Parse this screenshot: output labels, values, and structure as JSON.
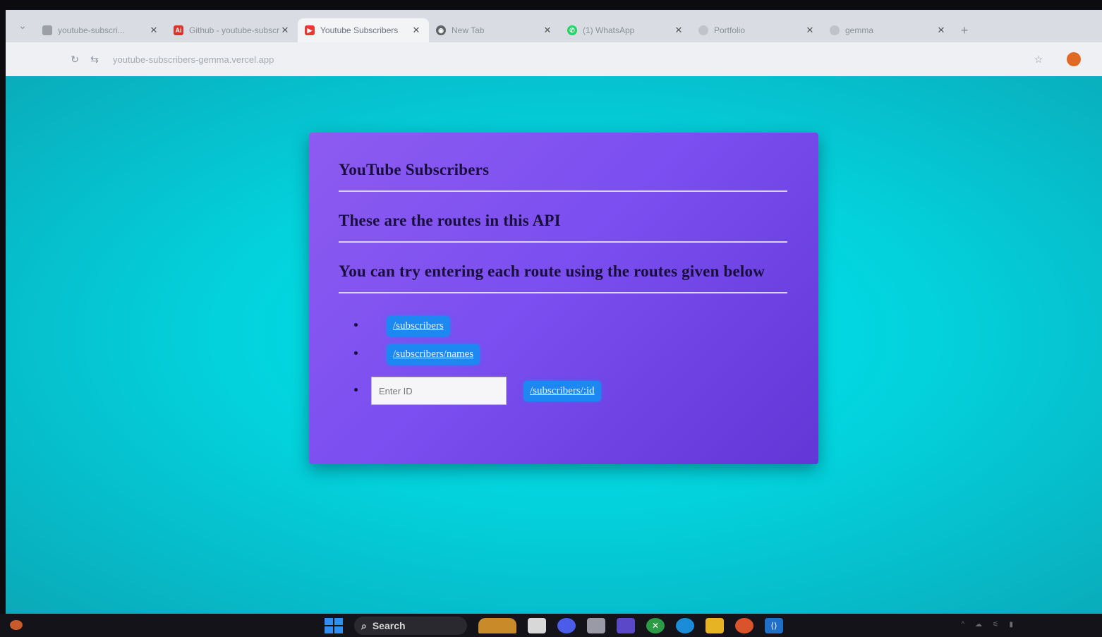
{
  "browser": {
    "tabs": [
      {
        "title": "youtube-subscri...",
        "favicon": "page-icon",
        "favicon_color": "#9aa0a6",
        "active": false
      },
      {
        "title": "Github - youtube-subscribers",
        "favicon": "ai-icon",
        "favicon_color": "#d9342b",
        "active": false
      },
      {
        "title": "Youtube Subscribers",
        "favicon": "youtube-icon",
        "favicon_color": "#e53935",
        "active": true
      },
      {
        "title": "New Tab",
        "favicon": "chrome-icon",
        "favicon_color": "#5f6368",
        "active": false
      },
      {
        "title": "(1) WhatsApp",
        "favicon": "whatsapp-icon",
        "favicon_color": "#25d366",
        "active": false
      },
      {
        "title": "Portfolio",
        "favicon": "globe-icon",
        "favicon_color": "#c0c4ca",
        "active": false
      },
      {
        "title": "gemma",
        "favicon": "globe-icon",
        "favicon_color": "#c0c4ca",
        "active": false
      }
    ],
    "new_tab_label": "+",
    "url": "youtube-subscribers-gemma.vercel.app"
  },
  "page": {
    "heading": "YouTube Subscribers",
    "subheading": "These are the routes in this API",
    "instruction": "You can try entering each route using the routes given below",
    "routes": {
      "all": "/subscribers",
      "names": "/subscribers/names",
      "by_id": "/subscribers/:id"
    },
    "id_input_placeholder": "Enter ID"
  },
  "taskbar": {
    "search_label": "Search"
  },
  "colors": {
    "page_background": "#03d1dc",
    "card_background": "#7b4ff0",
    "route_button": "#1e88f2",
    "heading_text": "#180f3c"
  }
}
